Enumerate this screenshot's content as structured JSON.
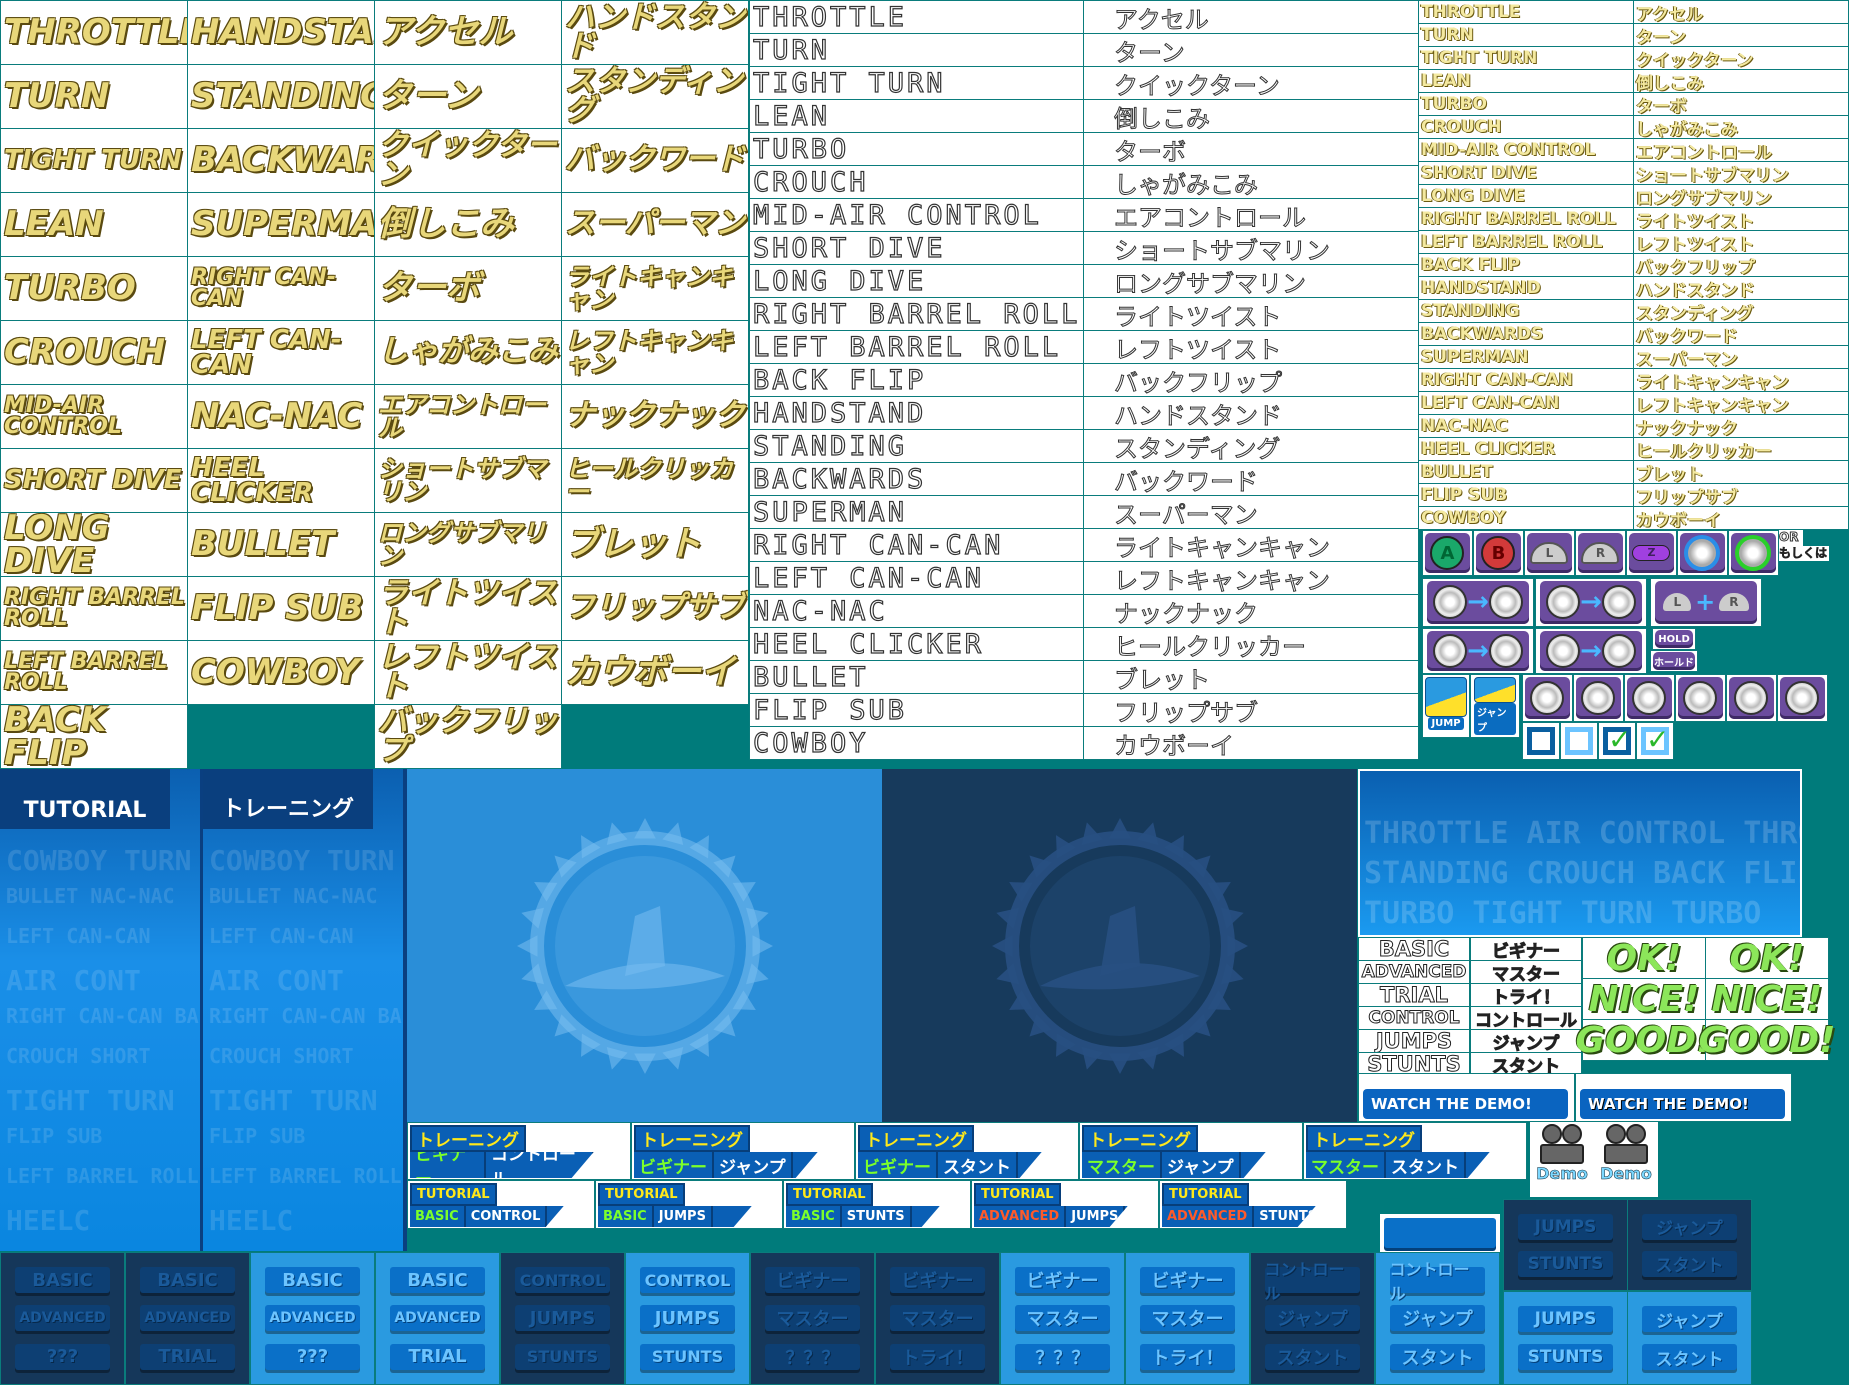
{
  "tricks": [
    {
      "en": "THROTTLE",
      "ja": "アクセル"
    },
    {
      "en": "TURN",
      "ja": "ターン"
    },
    {
      "en": "TIGHT TURN",
      "ja": "クイックターン"
    },
    {
      "en": "LEAN",
      "ja": "倒しこみ"
    },
    {
      "en": "TURBO",
      "ja": "ターボ"
    },
    {
      "en": "CROUCH",
      "ja": "しゃがみこみ"
    },
    {
      "en": "MID-AIR CONTROL",
      "ja": "エアコントロール"
    },
    {
      "en": "SHORT DIVE",
      "ja": "ショートサブマリン"
    },
    {
      "en": "LONG DIVE",
      "ja": "ロングサブマリン"
    },
    {
      "en": "RIGHT BARREL ROLL",
      "ja": "ライトツイスト"
    },
    {
      "en": "LEFT BARREL ROLL",
      "ja": "レフトツイスト"
    },
    {
      "en": "BACK FLIP",
      "ja": "バックフリップ"
    },
    {
      "en": "HANDSTAND",
      "ja": "ハンドスタンド"
    },
    {
      "en": "STANDING",
      "ja": "スタンディング"
    },
    {
      "en": "BACKWARDS",
      "ja": "バックワード"
    },
    {
      "en": "SUPERMAN",
      "ja": "スーパーマン"
    },
    {
      "en": "RIGHT CAN-CAN",
      "ja": "ライトキャンキャン"
    },
    {
      "en": "LEFT CAN-CAN",
      "ja": "レフトキャンキャン"
    },
    {
      "en": "NAC-NAC",
      "ja": "ナックナック"
    },
    {
      "en": "HEEL CLICKER",
      "ja": "ヒールクリッカー"
    },
    {
      "en": "BULLET",
      "ja": "ブレット"
    },
    {
      "en": "FLIP SUB",
      "ja": "フリップサブ"
    },
    {
      "en": "COWBOY",
      "ja": "カウボーイ"
    }
  ],
  "tutorial_panels": [
    {
      "title": "TUTORIAL"
    },
    {
      "title": "トレーニング"
    }
  ],
  "watermark_words": [
    "COWBOY TURN",
    "BULLET NAC-NAC",
    "LEFT CAN-CAN",
    "AIR CONT",
    "RIGHT CAN-CAN BACK",
    "CROUCH SHORT",
    "TIGHT TURN",
    "FLIP SUB",
    "LEFT BARREL ROLL",
    "HEELC"
  ],
  "texture_words": [
    "THROTTLE AIR CONTROL THROTTLE",
    "STANDING CROUCH BACK FLIP STANDING",
    "TURBO TIGHT TURN TURBO"
  ],
  "buttons": {
    "a": "A",
    "b": "B",
    "l": "L",
    "r": "R",
    "z": "Z",
    "or": "OR",
    "or_ja": "もしくは",
    "plus": "+",
    "hold": "HOLD",
    "hold_ja": "ホールド",
    "jump": "JUMP",
    "jump_ja": "ジャンプ"
  },
  "labels": [
    {
      "en": "BASIC",
      "ja": "ビギナー"
    },
    {
      "en": "ADVANCED",
      "ja": "マスター"
    },
    {
      "en": "TRIAL",
      "ja": "トライ！"
    },
    {
      "en": "CONTROL",
      "ja": "コントロール"
    },
    {
      "en": "JUMPS",
      "ja": "ジャンプ"
    },
    {
      "en": "STUNTS",
      "ja": "スタント"
    }
  ],
  "praise": [
    "OK!",
    "NICE!",
    "GOOD!"
  ],
  "watch_demo": "WATCH THE DEMO!",
  "demo": "Demo",
  "training_banners": [
    {
      "tab": "トレーニング",
      "level": "ビギナー",
      "topic": "コントロール"
    },
    {
      "tab": "トレーニング",
      "level": "ビギナー",
      "topic": "ジャンプ"
    },
    {
      "tab": "トレーニング",
      "level": "ビギナー",
      "topic": "スタント"
    },
    {
      "tab": "トレーニング",
      "level": "マスター",
      "topic": "ジャンプ"
    },
    {
      "tab": "トレーニング",
      "level": "マスター",
      "topic": "スタント"
    }
  ],
  "tutorial_banners": [
    {
      "tab": "TUTORIAL",
      "level": "BASIC",
      "topic": "CONTROL"
    },
    {
      "tab": "TUTORIAL",
      "level": "BASIC",
      "topic": "JUMPS"
    },
    {
      "tab": "TUTORIAL",
      "level": "BASIC",
      "topic": "STUNTS"
    },
    {
      "tab": "TUTORIAL",
      "level": "ADVANCED",
      "topic": "JUMPS"
    },
    {
      "tab": "TUTORIAL",
      "level": "ADVANCED",
      "topic": "STUNTS"
    }
  ],
  "menu_panels": [
    {
      "style": "dark",
      "items": [
        "BASIC",
        "ADVANCED",
        "???"
      ]
    },
    {
      "style": "dark",
      "items": [
        "BASIC",
        "ADVANCED",
        "TRIAL"
      ]
    },
    {
      "style": "light",
      "items": [
        "BASIC",
        "ADVANCED",
        "???"
      ]
    },
    {
      "style": "light",
      "items": [
        "BASIC",
        "ADVANCED",
        "TRIAL"
      ]
    },
    {
      "style": "dark",
      "items": [
        "CONTROL",
        "JUMPS",
        "STUNTS"
      ]
    },
    {
      "style": "light",
      "items": [
        "CONTROL",
        "JUMPS",
        "STUNTS"
      ]
    },
    {
      "style": "dark",
      "items": [
        "ビギナー",
        "マスター",
        "？？？"
      ]
    },
    {
      "style": "dark",
      "items": [
        "ビギナー",
        "マスター",
        "トライ！"
      ]
    },
    {
      "style": "light",
      "items": [
        "ビギナー",
        "マスター",
        "？？？"
      ]
    },
    {
      "style": "light",
      "items": [
        "ビギナー",
        "マスター",
        "トライ！"
      ]
    },
    {
      "style": "dark",
      "items": [
        "コントロール",
        "ジャンプ",
        "スタント"
      ]
    },
    {
      "style": "light",
      "items": [
        "コントロール",
        "ジャンプ",
        "スタント"
      ]
    }
  ],
  "small_panels": [
    {
      "style": "dark",
      "items": [
        "JUMPS",
        "STUNTS"
      ]
    },
    {
      "style": "dark",
      "items": [
        "ジャンプ",
        "スタント"
      ]
    },
    {
      "style": "light",
      "items": [
        "JUMPS",
        "STUNTS"
      ]
    },
    {
      "style": "light",
      "items": [
        "ジャンプ",
        "スタント"
      ]
    }
  ],
  "colors": {
    "background": "#007b7b",
    "gold": "#e8d77a",
    "praise_green": "#8ce65a",
    "basic_green": "#7cff2a",
    "advanced_red": "#ff5a2a",
    "tab_yellow": "#ffe81a"
  }
}
